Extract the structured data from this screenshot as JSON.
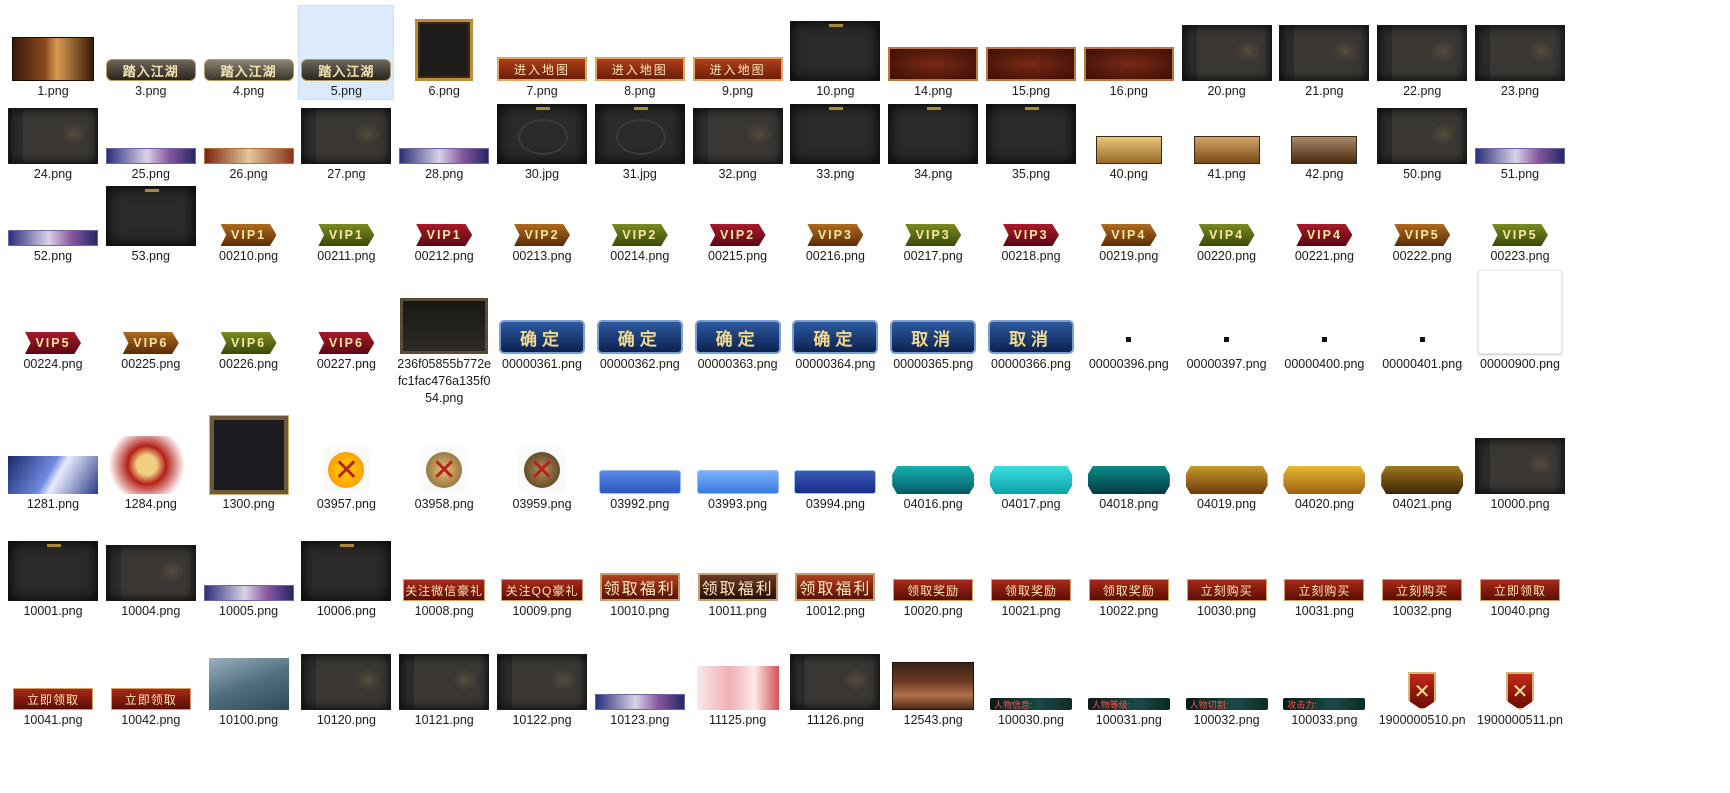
{
  "files": [
    {
      "name": "1.png",
      "kind": "t-1png"
    },
    {
      "name": "3.png",
      "kind": "t-btnjh",
      "text": "踏入江湖"
    },
    {
      "name": "4.png",
      "kind": "t-btnjh light",
      "text": "踏入江湖"
    },
    {
      "name": "5.png",
      "kind": "t-btnjh",
      "text": "踏入江湖",
      "selected": true
    },
    {
      "name": "6.png",
      "kind": "t-frame6"
    },
    {
      "name": "7.png",
      "kind": "t-ditu",
      "text": "进入地图"
    },
    {
      "name": "8.png",
      "kind": "t-ditu",
      "text": "进入地图"
    },
    {
      "name": "9.png",
      "kind": "t-ditu",
      "text": "进入地图"
    },
    {
      "name": "10.png",
      "kind": "t-dark"
    },
    {
      "name": "14.png",
      "kind": "t-red"
    },
    {
      "name": "15.png",
      "kind": "t-red"
    },
    {
      "name": "16.png",
      "kind": "t-red"
    },
    {
      "name": "20.png",
      "kind": "t-panel"
    },
    {
      "name": "21.png",
      "kind": "t-panel"
    },
    {
      "name": "22.png",
      "kind": "t-panel"
    },
    {
      "name": "23.png",
      "kind": "t-panel"
    },
    {
      "name": "24.png",
      "kind": "t-panel"
    },
    {
      "name": "25.png",
      "kind": "t-banner"
    },
    {
      "name": "26.png",
      "kind": "t-banner red"
    },
    {
      "name": "27.png",
      "kind": "t-panel"
    },
    {
      "name": "28.png",
      "kind": "t-banner"
    },
    {
      "name": "30.jpg",
      "kind": "t-dark swirl"
    },
    {
      "name": "31.jpg",
      "kind": "t-dark swirl"
    },
    {
      "name": "32.png",
      "kind": "t-panel"
    },
    {
      "name": "33.png",
      "kind": "t-dark"
    },
    {
      "name": "34.png",
      "kind": "t-dark"
    },
    {
      "name": "35.png",
      "kind": "t-dark"
    },
    {
      "name": "40.png",
      "kind": "t-gold",
      "bg": "linear-gradient(#e7c77a,#9a6a2a)"
    },
    {
      "name": "41.png",
      "kind": "t-gold",
      "bg": "linear-gradient(#d2a46a,#7a4a18)"
    },
    {
      "name": "42.png",
      "kind": "t-gold",
      "bg": "linear-gradient(#a88a6a,#4a2a10)"
    },
    {
      "name": "50.png",
      "kind": "t-panel"
    },
    {
      "name": "51.png",
      "kind": "t-banner"
    },
    {
      "name": "52.png",
      "kind": "t-banner"
    },
    {
      "name": "53.png",
      "kind": "t-dark"
    },
    {
      "name": "00210.png",
      "kind": "t-vip vip-brown",
      "text": "VIP1"
    },
    {
      "name": "00211.png",
      "kind": "t-vip vip-green",
      "text": "VIP1"
    },
    {
      "name": "00212.png",
      "kind": "t-vip vip-red",
      "text": "VIP1"
    },
    {
      "name": "00213.png",
      "kind": "t-vip vip-brown",
      "text": "VIP2"
    },
    {
      "name": "00214.png",
      "kind": "t-vip vip-green",
      "text": "VIP2"
    },
    {
      "name": "00215.png",
      "kind": "t-vip vip-red",
      "text": "VIP2"
    },
    {
      "name": "00216.png",
      "kind": "t-vip vip-brown",
      "text": "VIP3"
    },
    {
      "name": "00217.png",
      "kind": "t-vip vip-green",
      "text": "VIP3"
    },
    {
      "name": "00218.png",
      "kind": "t-vip vip-red",
      "text": "VIP3"
    },
    {
      "name": "00219.png",
      "kind": "t-vip vip-brown",
      "text": "VIP4"
    },
    {
      "name": "00220.png",
      "kind": "t-vip vip-green",
      "text": "VIP4"
    },
    {
      "name": "00221.png",
      "kind": "t-vip vip-red",
      "text": "VIP4"
    },
    {
      "name": "00222.png",
      "kind": "t-vip vip-brown",
      "text": "VIP5"
    },
    {
      "name": "00223.png",
      "kind": "t-vip vip-green",
      "text": "VIP5"
    },
    {
      "name": "00224.png",
      "kind": "t-vip vip-red",
      "text": "VIP5"
    },
    {
      "name": "00225.png",
      "kind": "t-vip vip-brown",
      "text": "VIP6"
    },
    {
      "name": "00226.png",
      "kind": "t-vip vip-green",
      "text": "VIP6"
    },
    {
      "name": "00227.png",
      "kind": "t-vip vip-red",
      "text": "VIP6"
    },
    {
      "name": "236f05855b772efc1fac476a135f054.png",
      "kind": "t-chest"
    },
    {
      "name": "00000361.png",
      "kind": "t-blue",
      "text": "确定"
    },
    {
      "name": "00000362.png",
      "kind": "t-blue",
      "text": "确定"
    },
    {
      "name": "00000363.png",
      "kind": "t-blue",
      "text": "确定"
    },
    {
      "name": "00000364.png",
      "kind": "t-blue",
      "text": "确定"
    },
    {
      "name": "00000365.png",
      "kind": "t-blue",
      "text": "取消"
    },
    {
      "name": "00000366.png",
      "kind": "t-blue",
      "text": "取消"
    },
    {
      "name": "00000396.png",
      "kind": "t-dot"
    },
    {
      "name": "00000397.png",
      "kind": "t-dot"
    },
    {
      "name": "00000400.png",
      "kind": "t-dot"
    },
    {
      "name": "00000401.png",
      "kind": "t-dot"
    },
    {
      "name": "00000900.png",
      "kind": "t-blank"
    },
    {
      "name": "1281.png",
      "kind": "t-1281"
    },
    {
      "name": "1284.png",
      "kind": "t-1284"
    },
    {
      "name": "1300.png",
      "kind": "t-1300"
    },
    {
      "name": "03957.png",
      "kind": "t-x",
      "variant": "x1"
    },
    {
      "name": "03958.png",
      "kind": "t-x",
      "variant": "x2"
    },
    {
      "name": "03959.png",
      "kind": "t-x",
      "variant": "x3"
    },
    {
      "name": "03992.png",
      "kind": "t-sky"
    },
    {
      "name": "03993.png",
      "kind": "t-sky light"
    },
    {
      "name": "03994.png",
      "kind": "t-sky dark"
    },
    {
      "name": "04016.png",
      "kind": "t-plaque pl-teal1"
    },
    {
      "name": "04017.png",
      "kind": "t-plaque pl-teal2"
    },
    {
      "name": "04018.png",
      "kind": "t-plaque pl-teal3"
    },
    {
      "name": "04019.png",
      "kind": "t-plaque pl-gold1"
    },
    {
      "name": "04020.png",
      "kind": "t-plaque pl-gold2"
    },
    {
      "name": "04021.png",
      "kind": "t-plaque pl-gold3"
    },
    {
      "name": "10000.png",
      "kind": "t-panel"
    },
    {
      "name": "10001.png",
      "kind": "t-dark"
    },
    {
      "name": "10004.png",
      "kind": "t-panel"
    },
    {
      "name": "10005.png",
      "kind": "t-banner"
    },
    {
      "name": "10006.png",
      "kind": "t-dark"
    },
    {
      "name": "10008.png",
      "kind": "t-redbtn",
      "text": "关注微信豪礼",
      "w": 82
    },
    {
      "name": "10009.png",
      "kind": "t-redbtn",
      "text": "关注QQ豪礼",
      "w": 82
    },
    {
      "name": "10010.png",
      "kind": "t-bigbtn",
      "text": "领取福利"
    },
    {
      "name": "10011.png",
      "kind": "t-bigbtn dark",
      "text": "领取福利"
    },
    {
      "name": "10012.png",
      "kind": "t-bigbtn",
      "text": "领取福利"
    },
    {
      "name": "10020.png",
      "kind": "t-redbtn",
      "text": "领取奖励",
      "w": 80
    },
    {
      "name": "10021.png",
      "kind": "t-redbtn",
      "text": "领取奖励",
      "w": 80
    },
    {
      "name": "10022.png",
      "kind": "t-redbtn",
      "text": "领取奖励",
      "w": 80
    },
    {
      "name": "10030.png",
      "kind": "t-redbtn",
      "text": "立刻购买",
      "w": 80
    },
    {
      "name": "10031.png",
      "kind": "t-redbtn",
      "text": "立刻购买",
      "w": 80
    },
    {
      "name": "10032.png",
      "kind": "t-redbtn",
      "text": "立刻购买",
      "w": 80
    },
    {
      "name": "10040.png",
      "kind": "t-redbtn",
      "text": "立即领取",
      "w": 80
    },
    {
      "name": "10041.png",
      "kind": "t-redbtn",
      "text": "立即领取",
      "w": 80
    },
    {
      "name": "10042.png",
      "kind": "t-redbtn",
      "text": "立即领取",
      "w": 80
    },
    {
      "name": "10100.png",
      "kind": "t-sword"
    },
    {
      "name": "10120.png",
      "kind": "t-panel"
    },
    {
      "name": "10121.png",
      "kind": "t-panel"
    },
    {
      "name": "10122.png",
      "kind": "t-panel"
    },
    {
      "name": "10123.png",
      "kind": "t-banner"
    },
    {
      "name": "11125.png",
      "kind": "t-girl"
    },
    {
      "name": "11126.png",
      "kind": "t-panel"
    },
    {
      "name": "12543.png",
      "kind": "t-12543"
    },
    {
      "name": "100030.png",
      "kind": "t-strip",
      "text": "人物信息:"
    },
    {
      "name": "100031.png",
      "kind": "t-strip",
      "text": "人物等级:"
    },
    {
      "name": "100032.png",
      "kind": "t-strip",
      "text": "人物切割:"
    },
    {
      "name": "100033.png",
      "kind": "t-strip",
      "text": "攻击力:"
    },
    {
      "name": "1900000510.pn",
      "kind": "t-shield",
      "text": "✕"
    },
    {
      "name": "1900000511.pn",
      "kind": "t-shield",
      "text": "✕"
    }
  ]
}
